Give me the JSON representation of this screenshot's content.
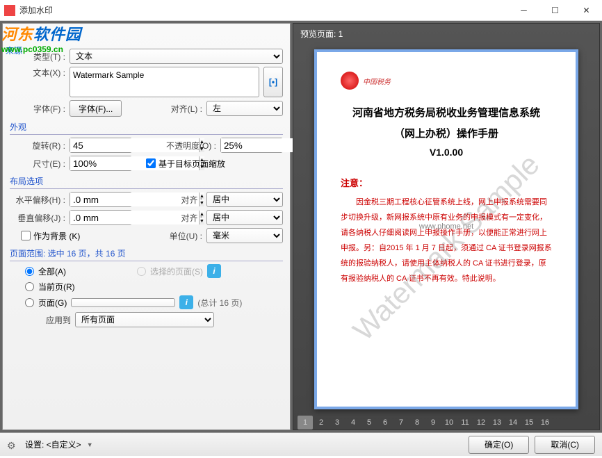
{
  "window": {
    "title": "添加水印"
  },
  "logo": {
    "text_a": "河东",
    "text_b": "软件园",
    "url": "www.pc0359.cn",
    "source_label": "来源"
  },
  "source": {
    "type_label": "类型(T) :",
    "type_value": "文本",
    "text_label": "文本(X) :",
    "text_value": "Watermark Sample",
    "font_label": "字体(F) :",
    "font_btn": "字体(F)...",
    "align_label": "对齐(L) :",
    "align_value": "左"
  },
  "appearance": {
    "head": "外观",
    "rotate_label": "旋转(R) :",
    "rotate_value": "45",
    "opacity_label": "不透明度(O) :",
    "opacity_value": "25%",
    "size_label": "尺寸(E) :",
    "size_value": "100%",
    "scale_chk": "基于目标页面缩放"
  },
  "layout": {
    "head": "布局选项",
    "hoff_label": "水平偏移(H) :",
    "hoff_value": ".0 mm",
    "halign_label": "对齐 :",
    "halign_value": "居中",
    "voff_label": "垂直偏移(J) :",
    "voff_value": ".0 mm",
    "valign_label": "对齐 :",
    "valign_value": "居中",
    "bg_chk": "作为背景 (K)",
    "unit_label": "单位(U) :",
    "unit_value": "毫米"
  },
  "range": {
    "head": "页面范围: 选中 16 页，共 16 页",
    "all": "全部(A)",
    "selected": "选择的页面(S)",
    "current": "当前页(R)",
    "pages": "页面(G)",
    "pages_value": "",
    "total": "(总计 16 页)",
    "apply_label": "应用到",
    "apply_value": "所有页面"
  },
  "preview": {
    "head": "预览页面: 1",
    "doc_title_l1": "河南省地方税务局税收业务管理信息系统",
    "doc_title_l2": "（网上办税）操作手册",
    "doc_version": "V1.0.00",
    "doc_note_head": "注意：",
    "doc_body": "因金税三期工程核心征管系统上线，网上申报系统需要同步切换升级，新网报系统中原有业务的申报模式有一定变化，请各纳税人仔细阅读网上申报操作手册，以便能正常进行网上申报。另：自2015 年 1 月 7 日起，须通过 CA 证书登录网报系统的报验纳税人，请使用主体纳税人的 CA 证书进行登录，原有报验纳税人的 CA 证书不再有效。特此说明。",
    "seal_txt": "中国税务",
    "watermark": "Watermark Sample",
    "site_overlay": "www.phome.net",
    "thumbs": [
      "1",
      "2",
      "3",
      "4",
      "5",
      "6",
      "7",
      "8",
      "9",
      "10",
      "11",
      "12",
      "13",
      "14",
      "15",
      "16"
    ]
  },
  "footer": {
    "settings": "设置: <自定义>",
    "ok": "确定(O)",
    "cancel": "取消(C)"
  }
}
